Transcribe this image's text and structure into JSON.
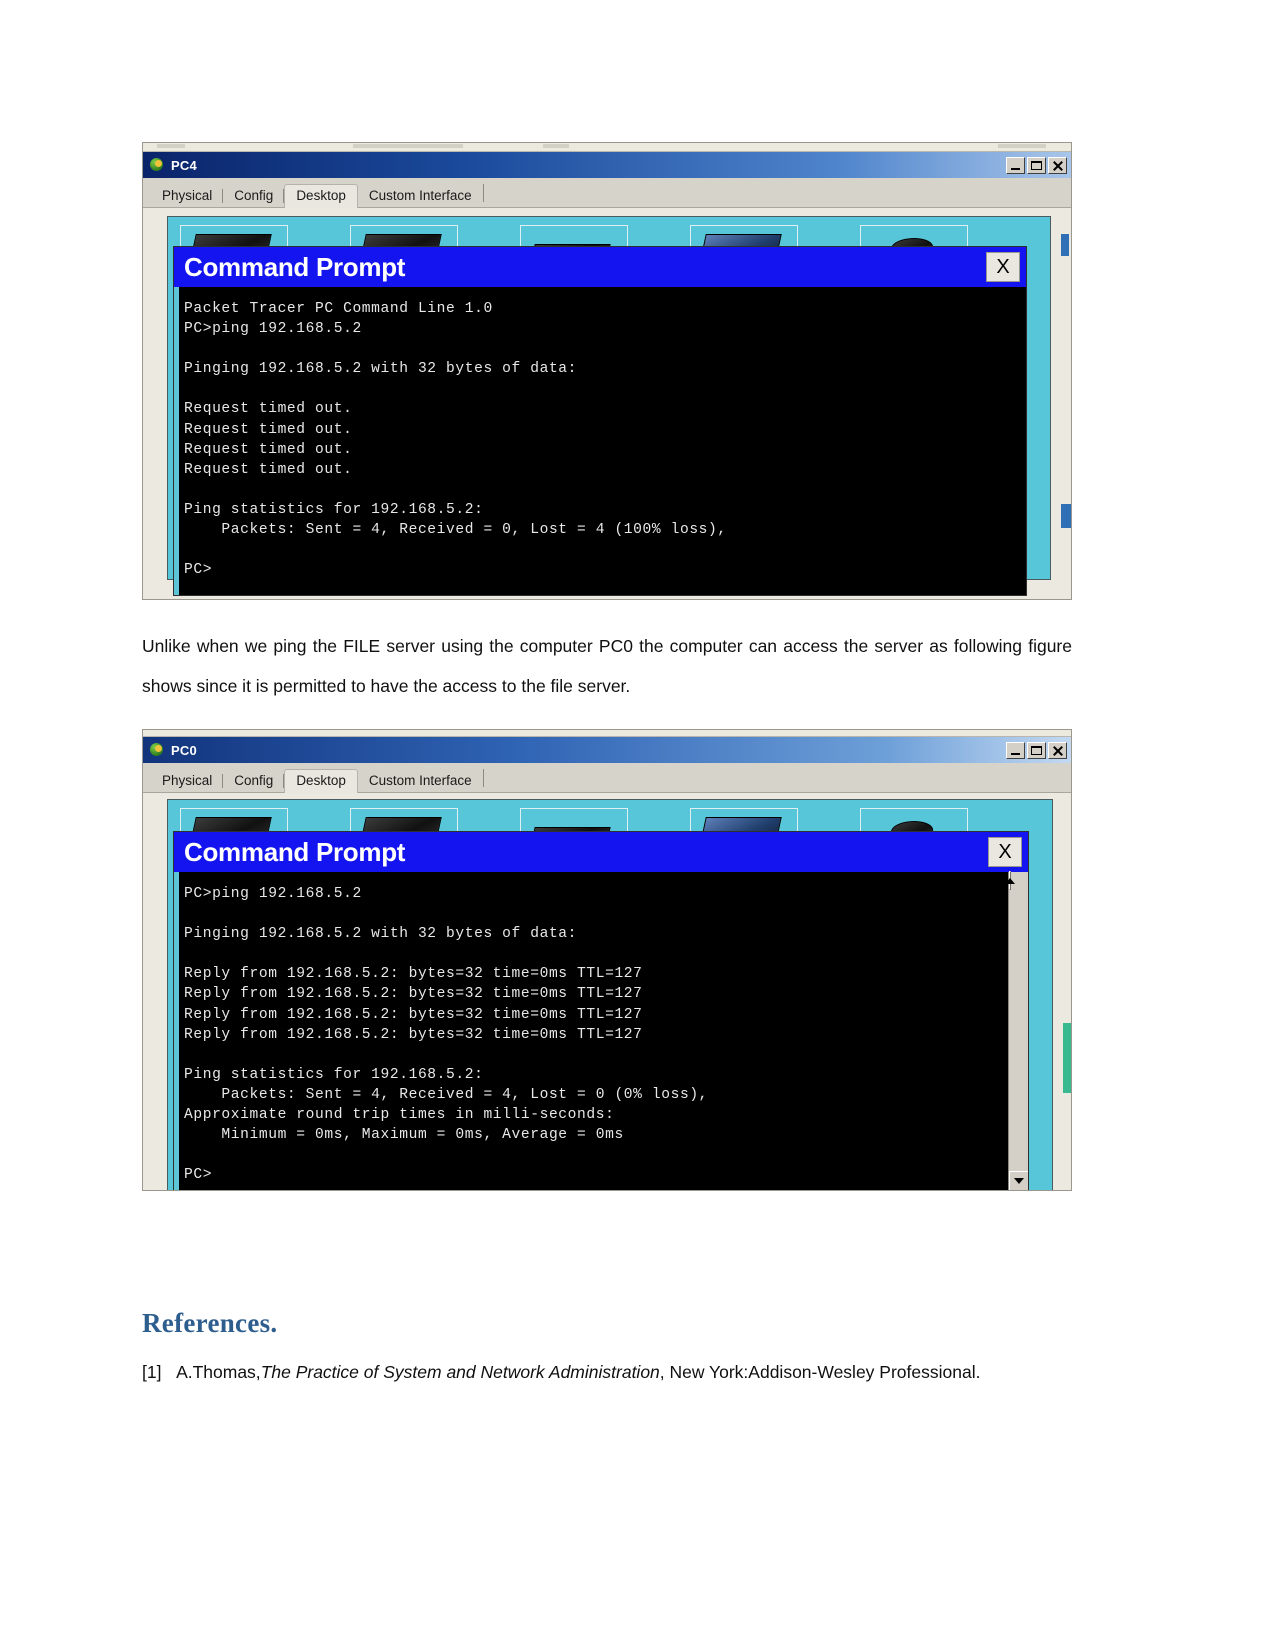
{
  "document": {
    "paragraph_1": "Unlike when we ping the FILE server using the computer PC0 the computer can access the server as following figure shows since it is permitted to have the access to the file server.",
    "references_heading": "References.",
    "reference_1": {
      "number": "[1]",
      "author": "A.Thomas,",
      "title_italic": "The Practice of System and Network Administration",
      "publisher": ", New York:Addison-Wesley Professional."
    }
  },
  "window_pc4": {
    "title": "PC4",
    "app_icon": "packet-tracer-globe-icon",
    "window_buttons": {
      "minimize": "minimize-icon",
      "maximize": "maximize-icon",
      "close": "close-icon"
    },
    "tabs": [
      {
        "label": "Physical",
        "active": false
      },
      {
        "label": "Config",
        "active": false
      },
      {
        "label": "Desktop",
        "active": true
      },
      {
        "label": "Custom Interface",
        "active": false
      }
    ],
    "command_prompt": {
      "title": "Command Prompt",
      "close_label": "X",
      "console_text": "Packet Tracer PC Command Line 1.0\nPC>ping 192.168.5.2\n\nPinging 192.168.5.2 with 32 bytes of data:\n\nRequest timed out.\nRequest timed out.\nRequest timed out.\nRequest timed out.\n\nPing statistics for 192.168.5.2:\n    Packets: Sent = 4, Received = 0, Lost = 4 (100% loss),\n\nPC>"
    }
  },
  "window_pc0": {
    "title": "PC0",
    "app_icon": "packet-tracer-globe-icon",
    "window_buttons": {
      "minimize": "minimize-icon",
      "maximize": "maximize-icon",
      "close": "close-icon"
    },
    "tabs": [
      {
        "label": "Physical",
        "active": false
      },
      {
        "label": "Config",
        "active": false
      },
      {
        "label": "Desktop",
        "active": true
      },
      {
        "label": "Custom Interface",
        "active": false
      }
    ],
    "command_prompt": {
      "title": "Command Prompt",
      "close_label": "X",
      "scroll_up": "scroll-up-arrow-icon",
      "scroll_down": "scroll-down-arrow-icon",
      "console_text": "PC>ping 192.168.5.2\n\nPinging 192.168.5.2 with 32 bytes of data:\n\nReply from 192.168.5.2: bytes=32 time=0ms TTL=127\nReply from 192.168.5.2: bytes=32 time=0ms TTL=127\nReply from 192.168.5.2: bytes=32 time=0ms TTL=127\nReply from 192.168.5.2: bytes=32 time=0ms TTL=127\n\nPing statistics for 192.168.5.2:\n    Packets: Sent = 4, Received = 4, Lost = 0 (0% loss),\nApproximate round trip times in milli-seconds:\n    Minimum = 0ms, Maximum = 0ms, Average = 0ms\n\nPC>"
    }
  },
  "colors": {
    "cmd_title_blue": "#1414f0",
    "desktop_teal": "#57c6d9",
    "heading_blue": "#2e5e8e",
    "titlebar_navy": "#0a246a"
  }
}
